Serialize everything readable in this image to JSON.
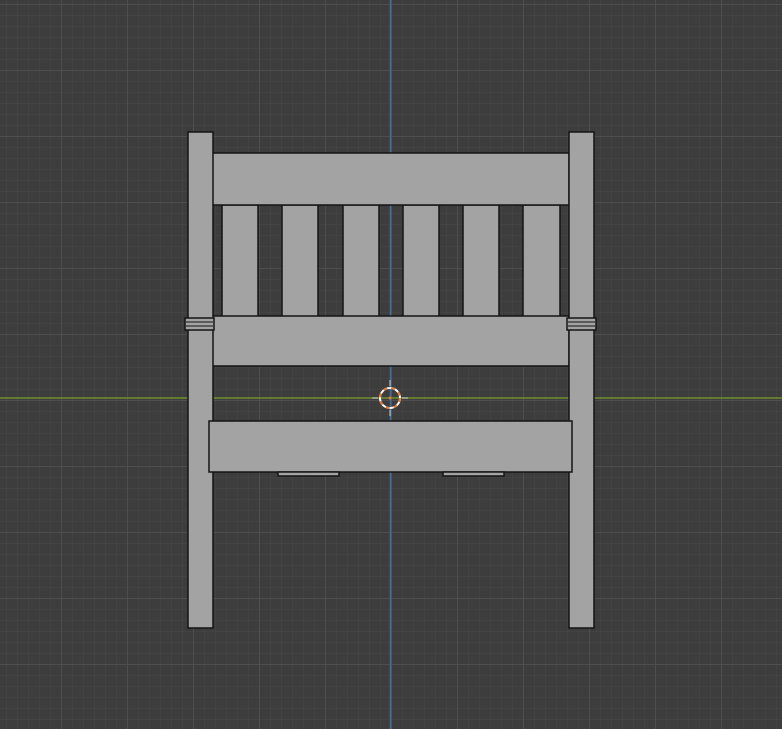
{
  "viewport": {
    "mode": "3D viewport",
    "colors": {
      "background": "#3d3d3d",
      "grid": "#505050",
      "x_axis": "#6e8f2e",
      "y_axis": "#3f6fa6",
      "model_fill": "#a3a3a3",
      "model_outline": "#151515",
      "cursor": "#e07a3a"
    }
  },
  "model": {
    "object": "chair",
    "slat_count": 6,
    "view": "front"
  },
  "cursor": {
    "icon": "3d-cursor-icon"
  }
}
